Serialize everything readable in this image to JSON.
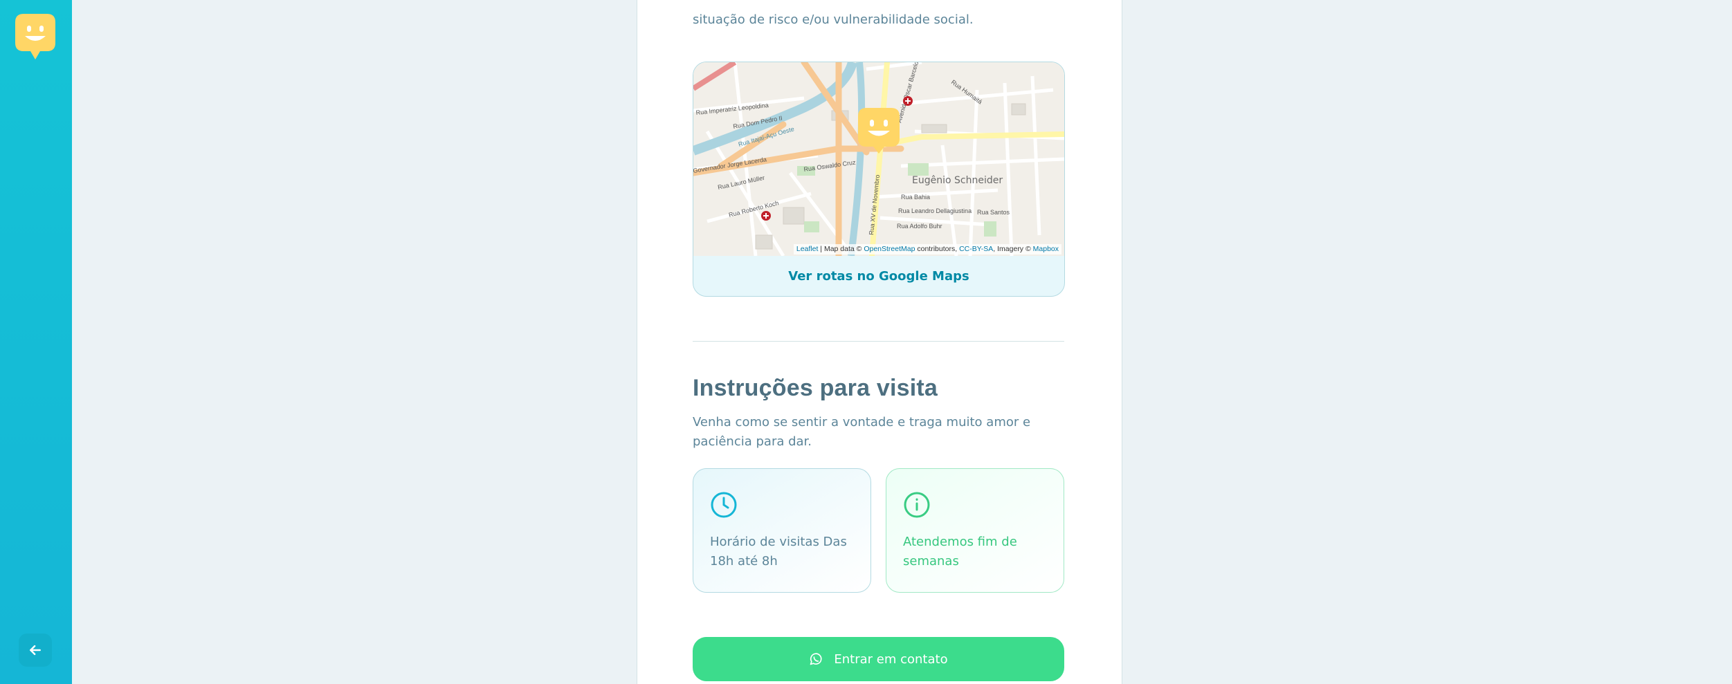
{
  "sidebar": {
    "logo_icon": "happy-face-logo-icon",
    "back_icon": "arrow-left-icon",
    "colors": {
      "background": "#15c3d6",
      "logo": "#ffd666"
    }
  },
  "details": {
    "description_tail": "situação de risco e/ou vulnerabilidade social."
  },
  "map": {
    "marker_icon": "happy-face-marker-icon",
    "district_label": "Eugênio Schneider",
    "street_labels": [
      "Rua Imperatriz Leopoldina",
      "Rua Dom Pedro II",
      "Rua Itajaí-Açu Oeste",
      "Governador Jorge Lacerda",
      "Rua Lauro Müller",
      "Rua Roberto Koch",
      "Rua XV de Novembro",
      "Avenida Oscar Barcelos",
      "Rua Humaitá",
      "Rua Leandro Dellagiustina",
      "Rua Santos",
      "Rua Adolfo Buhr",
      "Rua Oswaldo Cruz",
      "Rua Bahia"
    ],
    "attribution": {
      "leaflet": "Leaflet",
      "sep1": " | Map data © ",
      "osm": "OpenStreetMap",
      "sep2": " contributors, ",
      "license": "CC-BY-SA",
      "sep3": ", Imagery © ",
      "mapbox": "Mapbox"
    },
    "routes_link": "Ver rotas no Google Maps"
  },
  "instructions": {
    "title": "Instruções para visita",
    "description": "Venha como se sentir a vontade e traga muito amor e paciência para dar.",
    "hours": {
      "icon": "clock-icon",
      "text": "Horário de visitas Das 18h até 8h"
    },
    "weekends": {
      "icon": "info-icon",
      "text": "Atendemos fim de semanas"
    }
  },
  "contact": {
    "icon": "whatsapp-icon",
    "label": "Entrar em contato",
    "color": "#3cdc8c"
  }
}
